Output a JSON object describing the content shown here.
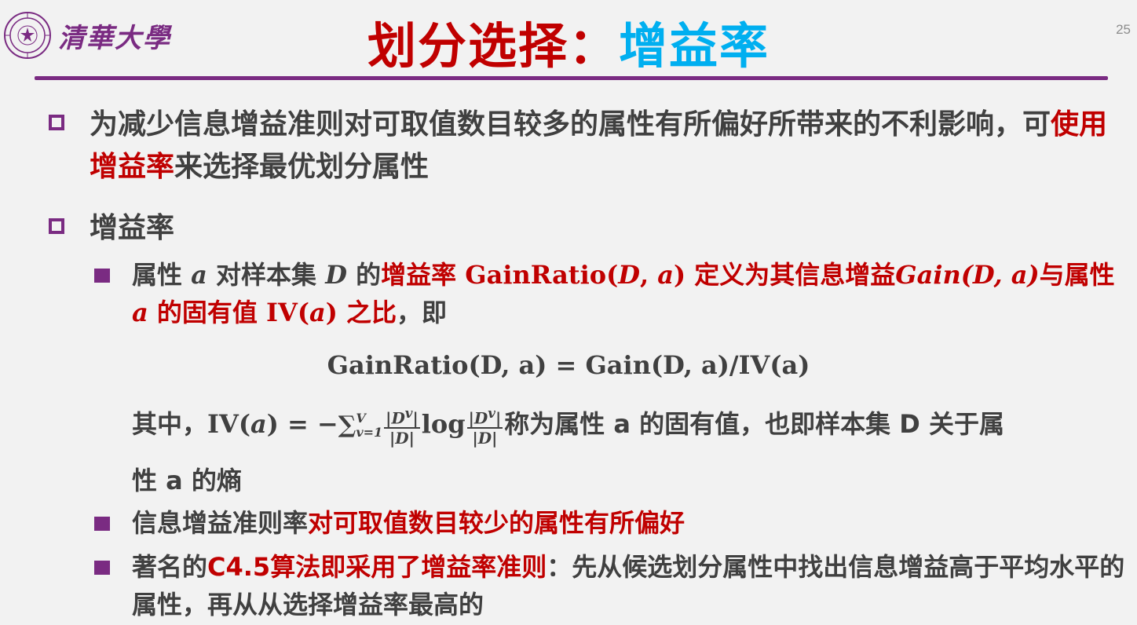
{
  "header": {
    "logo_text": "清華大學",
    "title_part1": "划分选择：",
    "title_part2": "增益率",
    "page_number": "25"
  },
  "bullets": {
    "b1": {
      "text_a": "为减少信息增益准则对可取值数目较多的属性有所偏好所带来的不利影响，可",
      "text_red": "使用增益率",
      "text_b": "来选择最优划分属性"
    },
    "b2": {
      "text": "增益率"
    },
    "s1": {
      "pre1": "属性 ",
      "var_a": "a",
      "pre2": " 对样本集 ",
      "var_D": "D",
      "pre3": " 的",
      "red1": "增益率 ",
      "red_fn": "GainRatio(",
      "red_D": "D",
      "red_comma": ", ",
      "red_a": "a",
      "red_close": ")",
      "red2": " 定义为其信息增益",
      "red_gain": "Gain(D, a)",
      "red3": "与属性 ",
      "red_a2": "a",
      "red4": " 的固有值 ",
      "red_iv": "IV(",
      "red_a3": "a",
      "red_iv_close": ")",
      "red5": " 之比",
      "tail": "，即"
    },
    "formula": "GainRatio(D, a) = Gain(D, a)/IV(a)",
    "iv": {
      "prefix": "其中，",
      "lhs": "IV(",
      "lhs_a": "a",
      "lhs_close": ") = −",
      "sum": "∑",
      "upper": "V",
      "lower": "v=1",
      "frac_num": "|D",
      "frac_sup": "v",
      "frac_num_close": "|",
      "frac_den": "|D|",
      "log": "log",
      "suffix": "称为属性 a 的固有值，也即样本集 D 关于属",
      "cont": "性 a 的熵"
    },
    "s2": {
      "text_a": "信息增益准则率",
      "text_red": "对可取值数目较少的属性有所偏好"
    },
    "s3": {
      "text_a": "著名的",
      "text_red": "C4.5算法即采用了增益率准则",
      "text_b": "：先从候选划分属性中找出信息增益高于平均水平的属性，再从从选择增益率最高的"
    }
  },
  "colors": {
    "accent_purple": "#7a2b82",
    "title_red": "#c00000",
    "title_blue": "#00aff0",
    "body_text": "#404040"
  }
}
